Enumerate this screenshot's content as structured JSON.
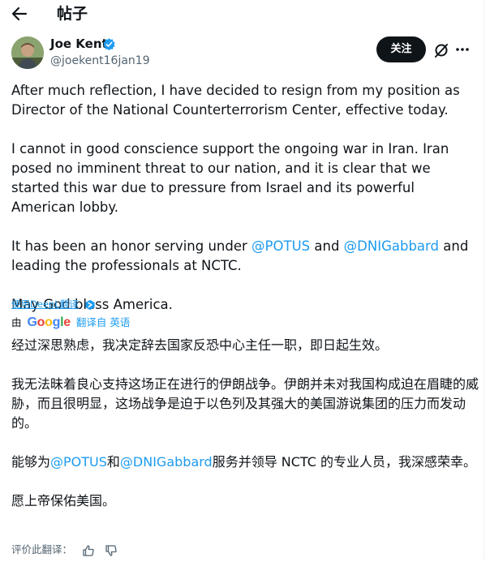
{
  "header": {
    "title": "帖子",
    "back_icon": "arrow-left-icon"
  },
  "author": {
    "name": "Joe Kent",
    "handle": "@joekent16jan19",
    "verified": true,
    "verified_color": "#1d9bf0"
  },
  "actions": {
    "follow_label": "关注",
    "grok_icon": "grok-icon",
    "more_icon": "more-horizontal-icon"
  },
  "tweet_en": {
    "p1": "After much reflection, I have decided to resign from my position as Director of the National Counterterrorism Center, effective today.",
    "p2": "I cannot in good conscience support the ongoing war in Iran. Iran posed no imminent threat to our nation, and it is clear that we started this war due to pressure from Israel and its powerful American lobby.",
    "p3_a": "It has been an honor serving under ",
    "mention_1": "@POTUS",
    "p3_b": " and ",
    "mention_2": "@DNIGabbard",
    "p3_c": " and leading the professionals at NCTC.",
    "p4": "May God bless America."
  },
  "deepl": {
    "link_label": "使用DeepL翻译"
  },
  "google_translate": {
    "by_label": "由",
    "logo_text": "Google",
    "translated_from": "翻译自 英语"
  },
  "tweet_zh": {
    "p1": "经过深思熟虑，我决定辞去国家反恐中心主任一职，即日起生效。",
    "p2": "我无法昧着良心支持这场正在进行的伊朗战争。伊朗并未对我国构成迫在眉睫的威胁，而且很明显，这场战争是迫于以色列及其强大的美国游说集团的压力而发动的。",
    "p3_a": "能够为",
    "mention_1": "@POTUS",
    "p3_b": "和",
    "mention_2": "@DNIGabbard",
    "p3_c": "服务并领导 NCTC 的专业人员，我深感荣幸。",
    "p4": "愿上帝保佑美国。"
  },
  "rating": {
    "label": "评价此翻译：",
    "up_icon": "thumbs-up-icon",
    "down_icon": "thumbs-down-icon"
  },
  "colors": {
    "link": "#1d9bf0",
    "text": "#0f1419",
    "muted": "#536471",
    "button_bg": "#0f1419"
  }
}
